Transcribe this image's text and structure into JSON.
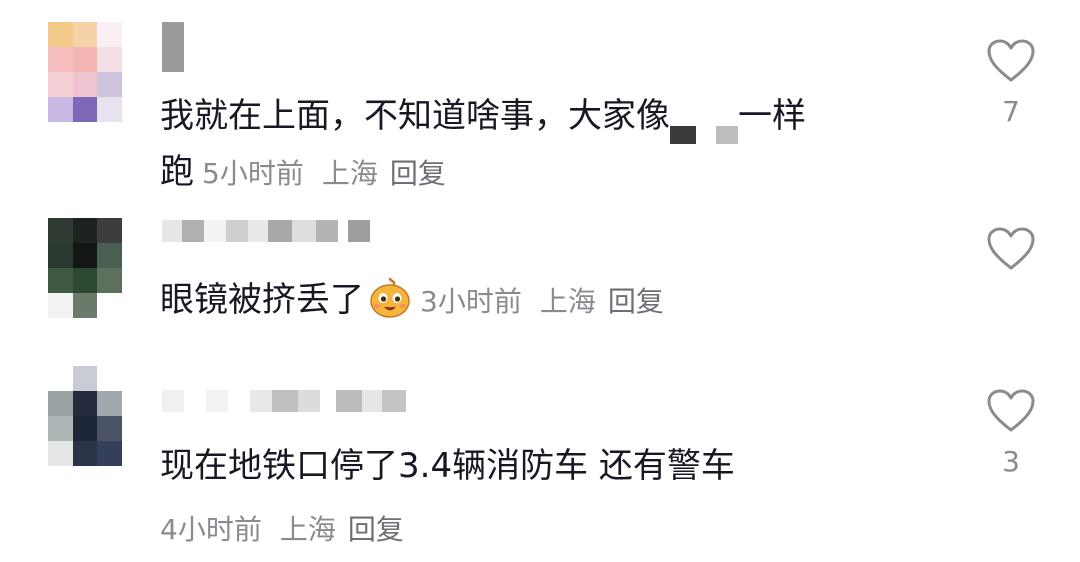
{
  "comments": [
    {
      "text_part1": "我就在上面，不知道啥事，大家像",
      "text_part2": "一样",
      "text_line2": "跑",
      "time": "5小时前",
      "location": "上海",
      "reply_label": "回复",
      "like_count": "7"
    },
    {
      "text": "眼镜被挤丢了",
      "emoji": "smiling-face-emoji",
      "time": "3小时前",
      "location": "上海",
      "reply_label": "回复",
      "like_count": ""
    },
    {
      "text": "现在地铁口停了3.4辆消防车 还有警车",
      "time": "4小时前",
      "location": "上海",
      "reply_label": "回复",
      "like_count": "3"
    }
  ],
  "icons": {
    "like": "heart-outline-icon",
    "redaction": "mosaic-redaction"
  },
  "colors": {
    "text": "#161823",
    "meta": "#8a8b91",
    "heart_stroke": "#8a8b91"
  }
}
